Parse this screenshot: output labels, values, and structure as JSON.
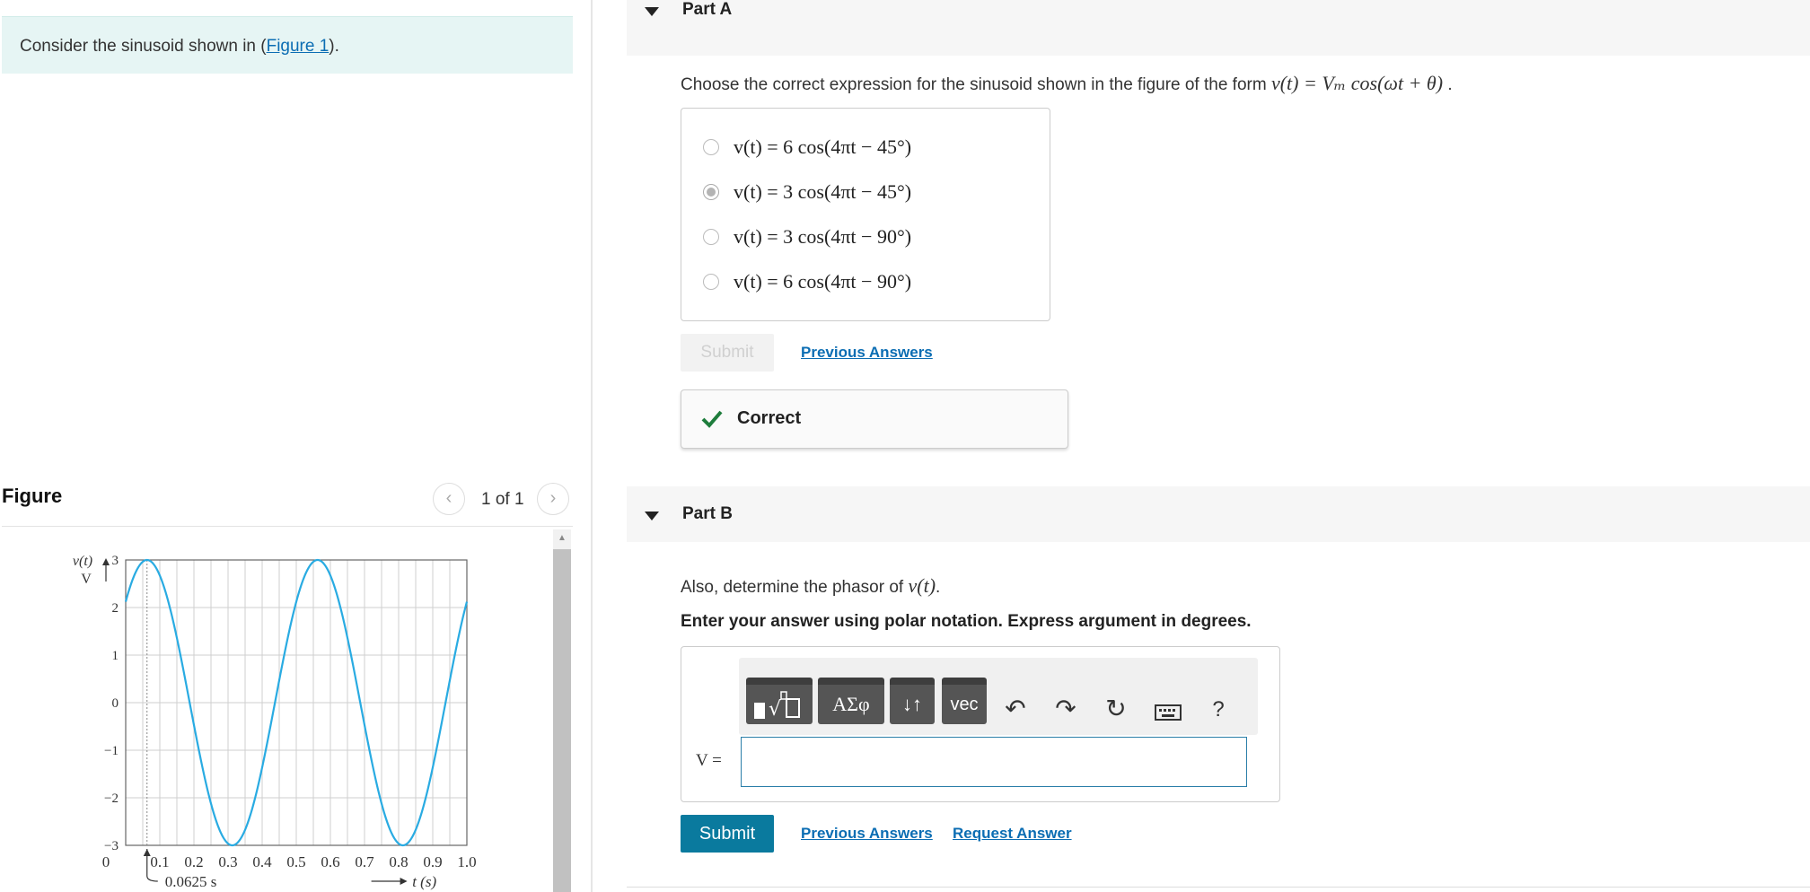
{
  "intro": {
    "text_before": "Consider the sinusoid shown in (",
    "figure_link": "Figure 1",
    "text_after": ")."
  },
  "figure": {
    "title": "Figure",
    "prev_icon": "chevron-left-icon",
    "next_icon": "chevron-right-icon",
    "counter": "1 of 1"
  },
  "chart_data": {
    "type": "line",
    "ylabel_top": "v(t)",
    "ylabel_unit": "V",
    "xlabel": "t (s)",
    "annotation": "0.0625 s",
    "x_ticks": [
      "0",
      "0.1",
      "0.2",
      "0.3",
      "0.4",
      "0.5",
      "0.6",
      "0.7",
      "0.8",
      "0.9",
      "1.0"
    ],
    "y_ticks": [
      "3",
      "2",
      "1",
      "0",
      "−1",
      "−2",
      "−3"
    ],
    "xlim": [
      0,
      1.0
    ],
    "ylim": [
      -3,
      3
    ],
    "grid": true,
    "color": "#29abe2",
    "series": [
      {
        "function": "3cos(4πt − 45°)",
        "amplitude": 3,
        "frequency_hz": 2,
        "phase_deg": -45
      }
    ]
  },
  "partA": {
    "title": "Part A",
    "question_before": "Choose the correct expression for the sinusoid shown in the figure of the form ",
    "question_formula": "v(t) = Vₘ cos(ωt + θ)",
    "question_after": " .",
    "choices": [
      {
        "label": "v(t) = 6 cos(4πt − 45°)",
        "selected": false
      },
      {
        "label": "v(t) = 3 cos(4πt − 45°)",
        "selected": true
      },
      {
        "label": "v(t) = 3 cos(4πt − 90°)",
        "selected": false
      },
      {
        "label": "v(t) = 6 cos(4πt − 90°)",
        "selected": false
      }
    ],
    "submit_label": "Submit",
    "previous_answers": "Previous Answers",
    "feedback": "Correct"
  },
  "partB": {
    "title": "Part B",
    "question_before": "Also, determine the phasor of ",
    "question_formula": "v(t)",
    "question_after": ".",
    "instruction": "Enter your answer using polar notation. Express argument in degrees.",
    "toolbar": {
      "templates_icon": "templates-icon",
      "symbols": "ΑΣφ",
      "arrows": "↓↑",
      "vec": "vec",
      "undo_icon": "undo-icon",
      "redo_icon": "redo-icon",
      "reset_icon": "reset-icon",
      "keyboard_icon": "keyboard-icon",
      "help": "?"
    },
    "input_label": "V =",
    "input_value": "",
    "submit_label": "Submit",
    "previous_answers": "Previous Answers",
    "request_answer": "Request Answer"
  },
  "colors": {
    "link": "#0b6db3",
    "submit": "#0a7a9e",
    "intro_bg": "#e6f5f4",
    "correct_check": "#1e7d3c",
    "curve": "#29abe2"
  }
}
